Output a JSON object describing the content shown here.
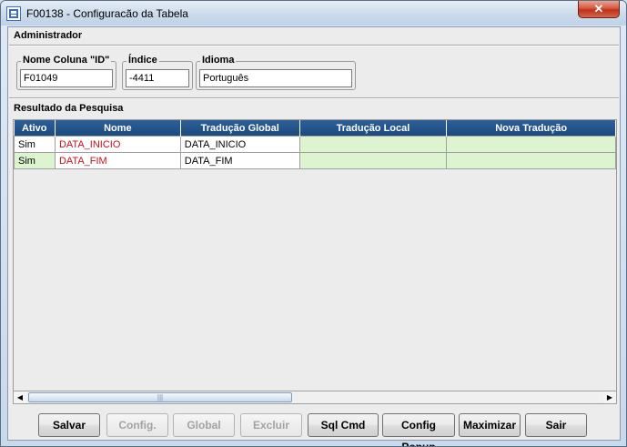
{
  "window": {
    "title": "F00138 - Configuracão da Tabela",
    "close_glyph": "✕"
  },
  "admin": {
    "section_title": "Administrador",
    "fields": [
      {
        "label": "Nome Coluna \"ID\"",
        "value": "F01049"
      },
      {
        "label": "Índice",
        "value": "-4411"
      },
      {
        "label": "Idioma",
        "value": "Português"
      }
    ]
  },
  "results": {
    "section_title": "Resultado da Pesquisa",
    "columns": [
      "Ativo",
      "Nome",
      "Tradução Global",
      "Tradução Local",
      "Nova Tradução"
    ],
    "rows": [
      {
        "ativo": "Sim",
        "nome": "DATA_INICIO",
        "global": "DATA_INICIO",
        "local": "",
        "nova": ""
      },
      {
        "ativo": "Sim",
        "nome": "DATA_FIM",
        "global": "DATA_FIM",
        "local": "",
        "nova": ""
      }
    ]
  },
  "scrollbar": {
    "left_arrow": "◀",
    "right_arrow": "▶",
    "grip": "|||"
  },
  "buttons": [
    {
      "label": "Salvar",
      "enabled": true
    },
    {
      "label": "Config.",
      "enabled": false
    },
    {
      "label": "Global",
      "enabled": false
    },
    {
      "label": "Excluir",
      "enabled": false
    },
    {
      "label": "Sql Cmd",
      "enabled": true
    },
    {
      "label": "Config Popup",
      "enabled": true
    },
    {
      "label": "Maximizar",
      "enabled": true
    },
    {
      "label": "Sair",
      "enabled": true
    }
  ],
  "colors": {
    "header_bg": "#1f4e86",
    "editable_cell": "#dcf5d0",
    "name_text": "#c0121d"
  }
}
